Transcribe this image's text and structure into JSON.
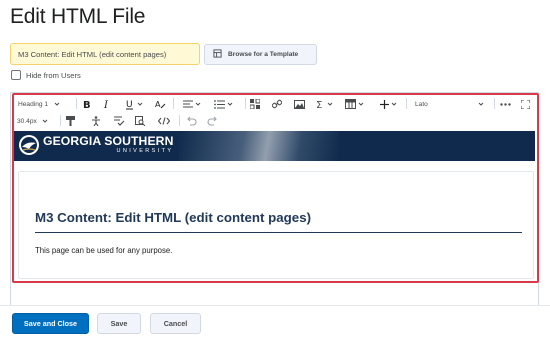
{
  "page": {
    "title": "Edit HTML File"
  },
  "title_field": {
    "value": "M3 Content: Edit HTML (edit content pages)"
  },
  "template_button": {
    "label": "Browse for a Template",
    "icon": "template-icon"
  },
  "hide_from_users": {
    "label": "Hide from Users",
    "checked": false
  },
  "toolbar": {
    "block_format": "Heading 1",
    "font_family": "Lato",
    "font_size": "30.4px",
    "icons": [
      "bold-icon",
      "italic-icon",
      "underline-icon",
      "text-color-icon",
      "align-icon",
      "list-icon",
      "insert-stuff-icon",
      "link-icon",
      "image-icon",
      "equation-icon",
      "table-icon",
      "insert-icon",
      "more-icon",
      "fullscreen-icon",
      "format-painter-icon",
      "accessibility-checker-icon",
      "spellcheck-icon",
      "preview-icon",
      "source-code-icon",
      "undo-icon",
      "redo-icon"
    ]
  },
  "banner": {
    "line1": "GEORGIA SOUTHERN",
    "line2": "UNIVERSITY",
    "background": "#0f2a4c"
  },
  "content": {
    "heading": "M3 Content: Edit HTML (edit content pages)",
    "paragraph": "This page can be used for any purpose."
  },
  "actions": {
    "save_close": "Save and Close",
    "save": "Save",
    "cancel": "Cancel"
  },
  "colors": {
    "primary": "#006fbf",
    "highlight_border": "#d93a4a",
    "heading": "#223a5a"
  }
}
